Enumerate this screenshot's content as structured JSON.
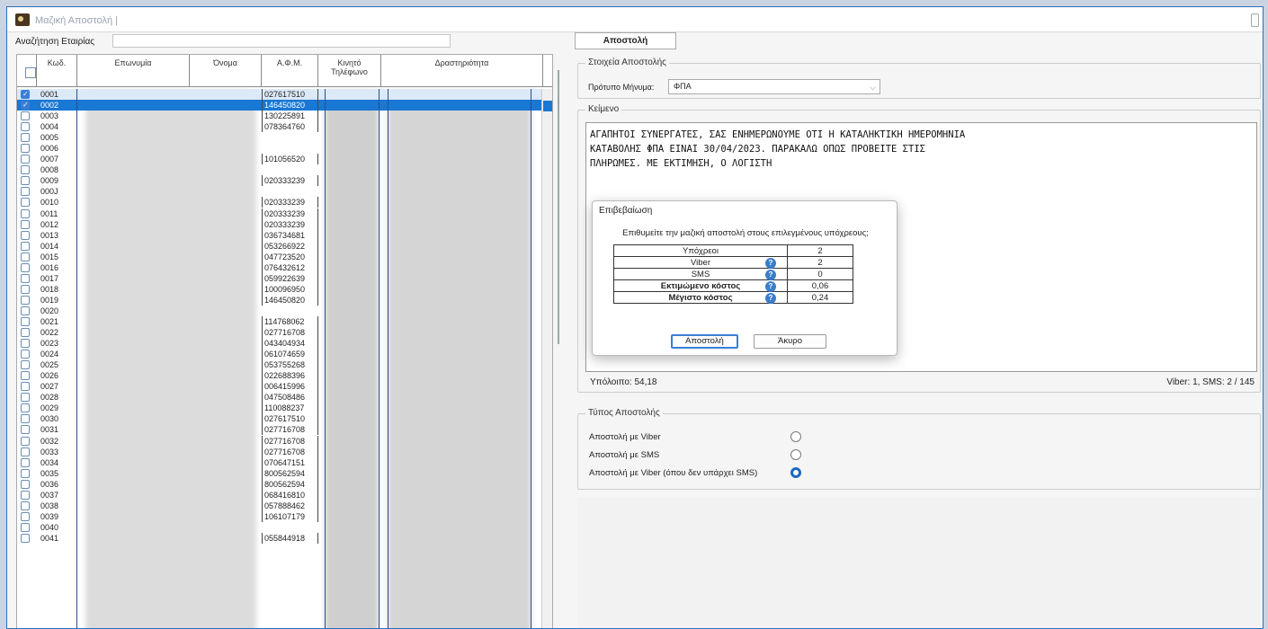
{
  "window": {
    "title": "Μαζική Αποστολή |"
  },
  "search": {
    "label": "Αναζήτηση Εταιρίας",
    "value": ""
  },
  "grid": {
    "headers": {
      "code": "Κωδ.",
      "name": "Επωνυμία",
      "first_name": "Όνομα",
      "afm": "Α.Φ.Μ.",
      "mobile": "Κινητό Τηλέφωνο",
      "activity": "Δραστηριότητα"
    },
    "rows": [
      {
        "code": "0001",
        "afm": "027617510",
        "checked": true
      },
      {
        "code": "0002",
        "afm": "146450820",
        "checked": true
      },
      {
        "code": "0003",
        "afm": "130225891",
        "checked": false
      },
      {
        "code": "0004",
        "afm": "078364760",
        "checked": false
      },
      {
        "code": "0005",
        "afm": "",
        "checked": false
      },
      {
        "code": "0006",
        "afm": "",
        "checked": false
      },
      {
        "code": "0007",
        "afm": "101056520",
        "checked": false
      },
      {
        "code": "0008",
        "afm": "",
        "checked": false
      },
      {
        "code": "0009",
        "afm": "020333239",
        "checked": false
      },
      {
        "code": "000J",
        "afm": "",
        "checked": false
      },
      {
        "code": "0010",
        "afm": "020333239",
        "checked": false
      },
      {
        "code": "0011",
        "afm": "020333239",
        "checked": false
      },
      {
        "code": "0012",
        "afm": "020333239",
        "checked": false
      },
      {
        "code": "0013",
        "afm": "036734681",
        "checked": false
      },
      {
        "code": "0014",
        "afm": "053266922",
        "checked": false
      },
      {
        "code": "0015",
        "afm": "047723520",
        "checked": false
      },
      {
        "code": "0016",
        "afm": "076432612",
        "checked": false
      },
      {
        "code": "0017",
        "afm": "059922639",
        "checked": false
      },
      {
        "code": "0018",
        "afm": "100096950",
        "checked": false
      },
      {
        "code": "0019",
        "afm": "146450820",
        "checked": false
      },
      {
        "code": "0020",
        "afm": "",
        "checked": false
      },
      {
        "code": "0021",
        "afm": "114768062",
        "checked": false
      },
      {
        "code": "0022",
        "afm": "027716708",
        "checked": false
      },
      {
        "code": "0023",
        "afm": "043404934",
        "checked": false
      },
      {
        "code": "0024",
        "afm": "061074659",
        "checked": false
      },
      {
        "code": "0025",
        "afm": "053755268",
        "checked": false
      },
      {
        "code": "0026",
        "afm": "022688396",
        "checked": false
      },
      {
        "code": "0027",
        "afm": "006415996",
        "checked": false
      },
      {
        "code": "0028",
        "afm": "047508486",
        "checked": false
      },
      {
        "code": "0029",
        "afm": "110088237",
        "checked": false
      },
      {
        "code": "0030",
        "afm": "027617510",
        "checked": false
      },
      {
        "code": "0031",
        "afm": "027716708",
        "checked": false
      },
      {
        "code": "0032",
        "afm": "027716708",
        "checked": false
      },
      {
        "code": "0033",
        "afm": "027716708",
        "checked": false
      },
      {
        "code": "0034",
        "afm": "070647151",
        "checked": false
      },
      {
        "code": "0035",
        "afm": "800562594",
        "checked": false
      },
      {
        "code": "0036",
        "afm": "800562594",
        "checked": false
      },
      {
        "code": "0037",
        "afm": "068416810",
        "checked": false
      },
      {
        "code": "0038",
        "afm": "057888462",
        "checked": false
      },
      {
        "code": "0039",
        "afm": "106107179",
        "checked": false
      },
      {
        "code": "0040",
        "afm": "",
        "checked": false
      },
      {
        "code": "0041",
        "afm": "055844918",
        "checked": false
      }
    ]
  },
  "send_button": "Αποστολή",
  "details": {
    "group_label": "Στοιχεία Αποστολής",
    "template_label": "Πρότυπο Μήνυμα:",
    "template_value": "ΦΠΑ"
  },
  "text": {
    "group_label": "Κείμενο",
    "body": "ΑΓΑΠΗΤΟΙ ΣΥΝΕΡΓΑΤΕΣ, ΣΑΣ ΕΝΗΜΕΡΩΝΟΥΜΕ ΟΤΙ Η ΚΑΤΑΛΗΚΤΙΚΗ ΗΜΕΡΟΜΗΝΙΑ\nΚΑΤΑΒΟΛΗΣ ΦΠΑ ΕΙΝΑΙ 30/04/2023. ΠΑΡΑΚΑΛΩ ΟΠΩΣ ΠΡΟΒΕΙΤΕ ΣΤΙΣ\nΠΛΗΡΩΜΕΣ. ΜΕ ΕΚΤΙΜΗΣΗ, Ο ΛΟΓΙΣΤΗ",
    "balance": "Υπόλοιπο:  54,18",
    "counter": "Viber: 1,  SMS: 2 / 145"
  },
  "send_type": {
    "group_label": "Τύπος Αποστολής",
    "options": [
      {
        "label": "Αποστολή με Viber",
        "selected": false
      },
      {
        "label": "Αποστολή με SMS",
        "selected": false
      },
      {
        "label": "Αποστολή με Viber (όπου δεν υπάρχει SMS)",
        "selected": true
      }
    ]
  },
  "dialog": {
    "title": "Επιβεβαίωση",
    "message": "Επιθυμείτε την μαζική αποστολή στους επιλεγμένους υπόχρεους;",
    "rows": [
      {
        "label": "Υπόχρεοι",
        "value": "2",
        "help": false,
        "bold": false
      },
      {
        "label": "Viber",
        "value": "2",
        "help": true,
        "bold": false
      },
      {
        "label": "SMS",
        "value": "0",
        "help": true,
        "bold": false
      },
      {
        "label": "Εκτιμώμενο κόστος",
        "value": "0,06",
        "help": true,
        "bold": true
      },
      {
        "label": "Μέγιστο κόστος",
        "value": "0,24",
        "help": true,
        "bold": true
      }
    ],
    "send_label": "Αποστολή",
    "cancel_label": "Άκυρο"
  },
  "colors": {
    "accent": "#1978d4",
    "radio_on": "#1d68c6",
    "help_icon": "#3a7ec9"
  }
}
